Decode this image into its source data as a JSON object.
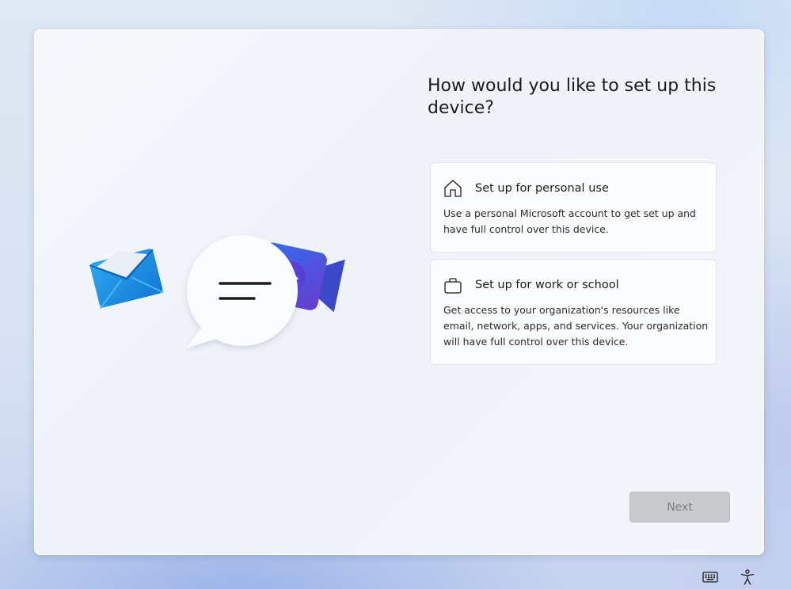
{
  "page": {
    "title": "How would you like to set up this device?"
  },
  "options": [
    {
      "icon": "home-icon",
      "title": "Set up for personal use",
      "description": "Use a personal Microsoft account to get set up and have full control over this device."
    },
    {
      "icon": "briefcase-icon",
      "title": "Set up for work or school",
      "description": "Get access to your organization's resources like email, network, apps, and services. Your organization will have full control over this device."
    }
  ],
  "footer": {
    "next_label": "Next",
    "next_enabled": false
  },
  "tray": {
    "keyboard_icon": "keyboard-icon",
    "accessibility_icon": "accessibility-icon"
  },
  "colors": {
    "mail_blue": "#1f8fe0",
    "video_purple": "#4a4fd8",
    "disabled_button": "#c8cacd"
  }
}
